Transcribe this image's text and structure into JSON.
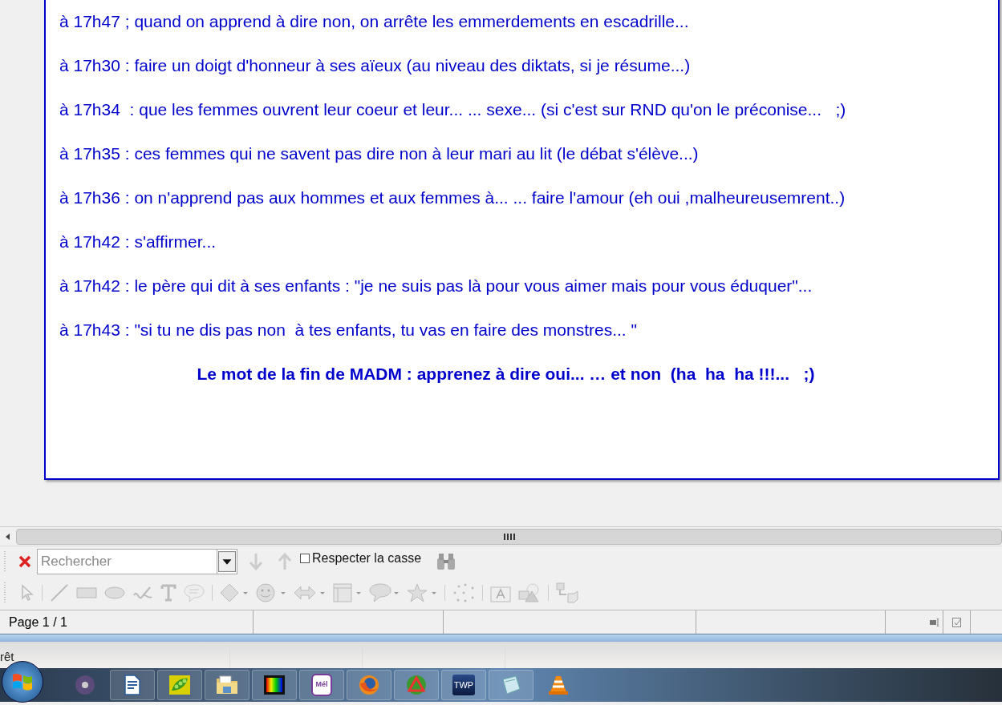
{
  "document": {
    "lines": [
      {
        "text": "à 17h47 ; quand on apprend à dire non, on arrête les emmerdements en escadrille..."
      },
      {
        "text": "à 17h30 : faire un doigt d'honneur à ses aïeux (au niveau des diktats, si je résume...)"
      },
      {
        "text": "à 17h34  : que les femmes ouvrent leur coeur et leur... ... sexe... (si c'est sur RND qu'on le préconise...   ;)"
      },
      {
        "text": "à 17h35 : ces femmes qui ne savent pas dire non à leur mari au lit (le débat s'élève...)"
      },
      {
        "text": "à 17h36 : on n'apprend pas aux hommes et aux femmes à... ... faire l'amour (eh oui ,malheureusemrent..)"
      },
      {
        "text": "à 17h42 : s'affirmer..."
      },
      {
        "text": "à 17h42 : le père qui dit à ses enfants : \"je ne suis pas là pour vous aimer mais pour vous éduquer\"..."
      },
      {
        "text": "à 17h43 : \"si tu ne dis pas non  à tes enfants, tu vas en faire des monstres... \""
      }
    ],
    "closing": "Le mot de la fin de MADM : apprenez à dire oui... … et non  (ha  ha  ha !!!...   ;)"
  },
  "find_toolbar": {
    "search": {
      "placeholder": "Rechercher"
    },
    "match_case": {
      "label": "Respecter la casse",
      "checked": false
    }
  },
  "status_bar": {
    "page": "Page 1 / 1"
  },
  "background_window": {
    "status_text": "rêt"
  },
  "taskbar": {
    "apps": [
      {
        "kind": "disc"
      },
      {
        "kind": "writer"
      },
      {
        "kind": "pea"
      },
      {
        "kind": "folder"
      },
      {
        "kind": "film"
      },
      {
        "kind": "mail",
        "label": "Mél"
      },
      {
        "kind": "firefox"
      },
      {
        "kind": "triangle"
      },
      {
        "kind": "badge",
        "label": "TWP"
      },
      {
        "kind": "notepad"
      },
      {
        "kind": "cone"
      }
    ]
  }
}
